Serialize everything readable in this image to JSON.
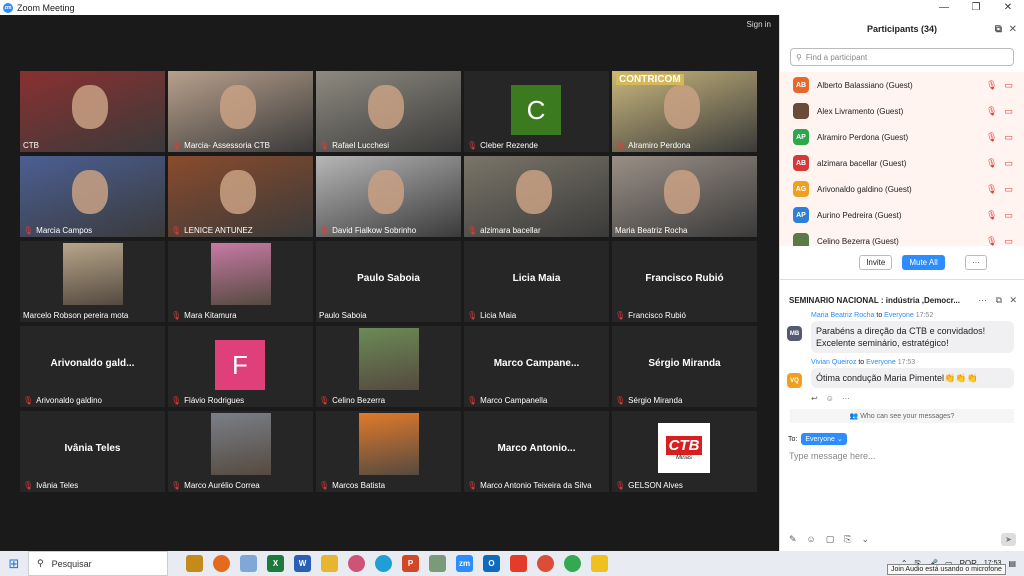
{
  "window": {
    "title": "Zoom Meeting",
    "controls": [
      "—",
      "❐",
      "✕"
    ]
  },
  "video": {
    "signin": "Sign in",
    "tiles": [
      {
        "name": "CTB",
        "kind": "cam",
        "bg": "#8a3030",
        "active": true,
        "mic": false
      },
      {
        "name": "Marcia- Assessoria CTB",
        "kind": "cam",
        "bg": "#b8a08c",
        "mic": true
      },
      {
        "name": "Rafael Lucchesi",
        "kind": "cam",
        "bg": "#8e8a80",
        "mic": true
      },
      {
        "name": "Cleber Rezende",
        "kind": "letter",
        "letter": "C",
        "letterColor": "#3c7a20",
        "mic": true
      },
      {
        "name": "Alramiro Perdona",
        "kind": "cam",
        "bg": "#c9b77d",
        "mic": true,
        "overlay": "CONTRICOM"
      },
      {
        "name": "Marcia Campos",
        "kind": "cam",
        "bg": "#4b5f94",
        "mic": true
      },
      {
        "name": "LENICE ANTUNEZ",
        "kind": "cam",
        "bg": "#8a4b2c",
        "mic": true
      },
      {
        "name": "David Fialkow Sobrinho",
        "kind": "cam",
        "bg": "#b6b6b6",
        "mic": true
      },
      {
        "name": "alzimara bacellar",
        "kind": "cam",
        "bg": "#7a7568",
        "mic": true
      },
      {
        "name": "Maria Beatriz Rocha",
        "kind": "cam",
        "bg": "#9a8f86",
        "mic": false
      },
      {
        "name": "Marcelo Robson pereira mota",
        "kind": "photo",
        "bg": "#b7a68a",
        "mic": false
      },
      {
        "name": "Mara Kitamura",
        "kind": "photo",
        "bg": "#c87aa5",
        "mic": true
      },
      {
        "name": "Paulo Saboia",
        "kind": "text",
        "big": "Paulo Saboia",
        "mic": false
      },
      {
        "name": "Licia Maia",
        "kind": "text",
        "big": "Licia Maia",
        "mic": true
      },
      {
        "name": "Francisco Rubió",
        "kind": "text",
        "big": "Francisco Rubió",
        "mic": true
      },
      {
        "name": "Arivonaldo galdino",
        "kind": "text",
        "big": "Arivonaldo  gald...",
        "mic": true
      },
      {
        "name": "Flávio Rodrigues",
        "kind": "letter",
        "letter": "F",
        "letterColor": "#e0407a",
        "mic": true
      },
      {
        "name": "Celino Bezerra",
        "kind": "photo",
        "bg": "#6b8a55",
        "mic": true
      },
      {
        "name": "Marco Campanella",
        "kind": "text",
        "big": "Marco  Campane...",
        "mic": true
      },
      {
        "name": "Sérgio Miranda",
        "kind": "text",
        "big": "Sérgio Miranda",
        "mic": true
      },
      {
        "name": "Ivânia Teles",
        "kind": "text",
        "big": "Ivânia Teles",
        "mic": true
      },
      {
        "name": "Marco Aurélio Correa",
        "kind": "photo",
        "bg": "#7a7f88",
        "mic": true
      },
      {
        "name": "Marcos Batista",
        "kind": "photo",
        "bg": "#e07a2a",
        "mic": true
      },
      {
        "name": "Marco Antonio Teixeira da Silva",
        "kind": "text",
        "big": "Marco  Antonio...",
        "mic": true
      },
      {
        "name": "GELSON Alves",
        "kind": "logo",
        "logo": "CTB",
        "logoSub": "Minas",
        "mic": true
      }
    ]
  },
  "participants": {
    "title": "Participants (34)",
    "search_placeholder": "Find a participant",
    "list": [
      {
        "initials": "AB",
        "color": "#e8672a",
        "name": "Alberto Balassiano (Guest)"
      },
      {
        "initials": "",
        "color": "#6b4a3a",
        "name": "Alex Livramento (Guest)"
      },
      {
        "initials": "AP",
        "color": "#2aa84a",
        "name": "Alramiro Perdona (Guest)"
      },
      {
        "initials": "AB",
        "color": "#d6383a",
        "name": "alzimara bacellar (Guest)"
      },
      {
        "initials": "AG",
        "color": "#f0a020",
        "name": "Arivonaldo galdino (Guest)"
      },
      {
        "initials": "AP",
        "color": "#2d7fd9",
        "name": "Aurino Pedreira (Guest)"
      },
      {
        "initials": "",
        "color": "#5a7a4a",
        "name": "Celino Bezerra (Guest)"
      }
    ],
    "invite": "Invite",
    "mute_all": "Mute All",
    "more": "···"
  },
  "chat": {
    "title": "SEMINARIO NACIONAL : indústria ,Democr...",
    "messages": [
      {
        "avatar": "MB",
        "avatarColor": "#555a70",
        "from": "Maria Beatriz Rocha",
        "to_word": "to",
        "to": "Everyone",
        "time": "17:52",
        "text": "Parabéns a direção da CTB e convidados! Excelente seminário, estratégico!"
      },
      {
        "avatar": "VQ",
        "avatarColor": "#f0a020",
        "from": "Vivian Queiroz",
        "to_word": "to",
        "to": "Everyone",
        "time": "17:53",
        "text": "Ótima condução Maria Pimentel👏👏👏"
      }
    ],
    "who_can_see": "Who can see your messages?",
    "to_label": "To:",
    "to_value": "Everyone ⌄",
    "placeholder": "Type message here..."
  },
  "taskbar": {
    "search": "Pesquisar",
    "lang": "POR",
    "time": "17:53",
    "tooltip": "Join Audio está usando o microfone"
  }
}
